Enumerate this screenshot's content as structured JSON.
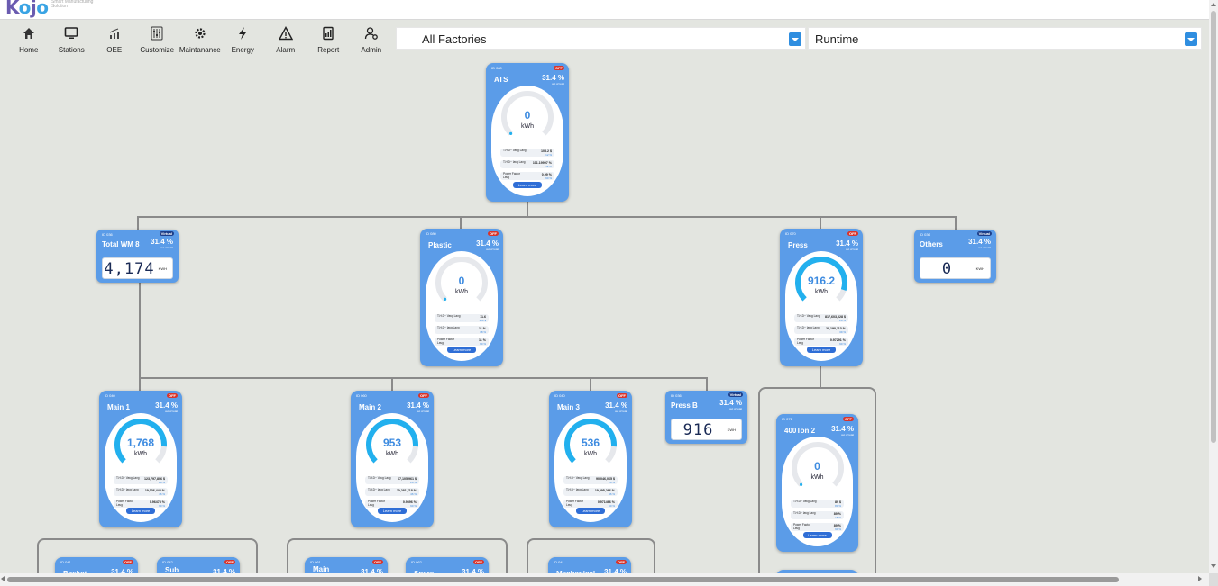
{
  "brand": {
    "logo": "Kojo",
    "tagline": "Smart Manufacturing Solution"
  },
  "nav": [
    {
      "label": "Home",
      "icon": "home-icon"
    },
    {
      "label": "Stations",
      "icon": "monitor-icon"
    },
    {
      "label": "OEE",
      "icon": "chart-icon"
    },
    {
      "label": "Customize",
      "icon": "sliders-icon"
    },
    {
      "label": "Maintanance",
      "icon": "gear-wrench-icon"
    },
    {
      "label": "Energy",
      "icon": "bolt-icon"
    },
    {
      "label": "Alarm",
      "icon": "warning-icon"
    },
    {
      "label": "Report",
      "icon": "report-icon"
    },
    {
      "label": "Admin",
      "icon": "admin-icon"
    }
  ],
  "filters": {
    "factory": "All Factories",
    "mode": "Runtime"
  },
  "common": {
    "percent": "31.4 %",
    "out_of_total": "out of total",
    "learn_more": "Learn more",
    "unit_kwh": "kWh",
    "unit_small": "KWH",
    "badge_off": "OFF",
    "badge_virtual": "Virtual"
  },
  "metric_labels": {
    "thd_v": "T.H.D~ Vavg Lavg",
    "thd_i": "T.H.D~ Iavg Lavg",
    "pf": "Power Factor Lavg"
  },
  "cards": {
    "ats": {
      "id": "ID 080",
      "name": "ATS",
      "value": "0",
      "gauge_fraction": 0.0,
      "m1": "103.2 $",
      "m1s": "12 %",
      "m2": "101.19997 %",
      "m2s": "46 %",
      "m3": "0.99 %",
      "m3s": "90 %"
    },
    "plastic": {
      "id": "ID 080",
      "name": "Plastic",
      "value": "0",
      "gauge_fraction": 0.0,
      "m1": "11.6",
      "m1s": "100 $",
      "m2": "11 %",
      "m2s": "18 %",
      "m3": "11 %",
      "m3s": "90 %"
    },
    "press": {
      "id": "ID 070",
      "name": "Press",
      "value": "916.2",
      "gauge_fraction": 0.9,
      "m1": "817,603,028 $",
      "m1s": "28 %",
      "m2": "20,190,113 %",
      "m2s": "39 %",
      "m3": "0.97291 %",
      "m3s": "90 %"
    },
    "main1": {
      "id": "ID 040",
      "name": "Main 1",
      "value": "1,768",
      "gauge_fraction": 0.85,
      "m1": "123,797,806 $",
      "m1s": "28 %",
      "m2": "19,036,448 %",
      "m2s": "46 %",
      "m3": "0.96478 %",
      "m3s": "90 %"
    },
    "main2": {
      "id": "ID 060",
      "name": "Main 2",
      "value": "953",
      "gauge_fraction": 0.85,
      "m1": "67,105,961 $",
      "m1s": "28 %",
      "m2": "20,281,718 %",
      "m2s": "46 %",
      "m3": "0.9396 %",
      "m3s": "90 %"
    },
    "main3": {
      "id": "ID 040",
      "name": "Main 3",
      "value": "536",
      "gauge_fraction": 0.85,
      "m1": "90,046,065 $",
      "m1s": "28 %",
      "m2": "19,895,266 %",
      "m2s": "46 %",
      "m3": "0.971466 %",
      "m3s": "90 %"
    },
    "ton400": {
      "id": "ID 071",
      "name": "400Ton 2",
      "value": "0",
      "gauge_fraction": 0.0,
      "m1": "89 $",
      "m1s": "80 %",
      "m2": "89 %",
      "m2s": "18 %",
      "m3": "89 %",
      "m3s": "90 %"
    }
  },
  "virtual_cards": {
    "wm8": {
      "id": "ID 036",
      "name": "Total WM 8",
      "value": "4,174"
    },
    "others": {
      "id": "ID 036",
      "name": "Others",
      "value": "0"
    },
    "pressb": {
      "id": "ID 036",
      "name": "Press B",
      "value": "916"
    }
  },
  "partial_cards": {
    "basket": {
      "id": "ID 041",
      "name": "Basket"
    },
    "sub": {
      "id": "ID 042",
      "name": "Sub"
    },
    "main_l": {
      "id": "ID 061",
      "name": "Main"
    },
    "spare": {
      "id": "ID 062",
      "name": "Spare"
    },
    "mechanical": {
      "id": "ID 041",
      "name": "Mechanical"
    }
  }
}
